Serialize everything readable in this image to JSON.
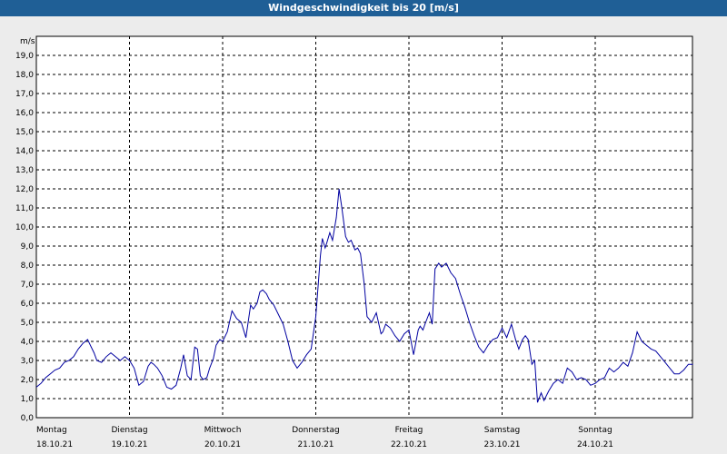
{
  "window": {
    "title": "Windgeschwindigkeit bis 20 [m/s]"
  },
  "chart_data": {
    "type": "line",
    "title": "Windgeschwindigkeit bis 20 [m/s]",
    "ylabel": "m/s",
    "ylim": [
      0,
      20
    ],
    "yticks": [
      "0,0",
      "1,0",
      "2,0",
      "3,0",
      "4,0",
      "5,0",
      "6,0",
      "7,0",
      "8,0",
      "9,0",
      "10,0",
      "11,0",
      "12,0",
      "13,0",
      "14,0",
      "15,0",
      "16,0",
      "17,0",
      "18,0",
      "19,0"
    ],
    "days": [
      {
        "name": "Montag",
        "date": "18.10.21"
      },
      {
        "name": "Dienstag",
        "date": "19.10.21"
      },
      {
        "name": "Mittwoch",
        "date": "20.10.21"
      },
      {
        "name": "Donnerstag",
        "date": "21.10.21"
      },
      {
        "name": "Freitag",
        "date": "22.10.21"
      },
      {
        "name": "Samstag",
        "date": "23.10.21"
      },
      {
        "name": "Sonntag",
        "date": "24.10.21"
      }
    ],
    "grid": true,
    "line_color": "#0000a0",
    "series": [
      {
        "x_days": [
          0.0,
          0.05,
          0.1,
          0.15,
          0.2,
          0.25,
          0.3,
          0.35,
          0.4,
          0.45,
          0.5,
          0.55,
          0.58,
          0.62,
          0.65,
          0.7,
          0.75,
          0.8,
          0.85,
          0.9,
          0.95,
          1.0,
          1.05,
          1.1,
          1.15,
          1.2,
          1.23,
          1.26,
          1.3,
          1.35,
          1.4,
          1.45,
          1.5,
          1.55,
          1.58,
          1.62,
          1.66,
          1.7,
          1.73,
          1.76,
          1.79,
          1.83,
          1.86,
          1.9,
          1.93,
          1.97,
          2.0,
          2.05,
          2.1,
          2.15,
          2.2,
          2.25,
          2.3,
          2.33,
          2.37,
          2.4,
          2.43,
          2.47,
          2.5,
          2.55,
          2.6,
          2.65,
          2.7,
          2.75,
          2.8,
          2.85,
          2.9,
          2.95,
          3.0,
          3.05,
          3.07,
          3.1,
          3.12,
          3.15,
          3.18,
          3.22,
          3.25,
          3.28,
          3.32,
          3.35,
          3.38,
          3.42,
          3.45,
          3.48,
          3.52,
          3.55,
          3.6,
          3.65,
          3.7,
          3.72,
          3.75,
          3.8,
          3.85,
          3.9,
          3.95,
          4.0,
          4.05,
          4.1,
          4.12,
          4.15,
          4.18,
          4.22,
          4.25,
          4.28,
          4.32,
          4.35,
          4.4,
          4.45,
          4.5,
          4.55,
          4.6,
          4.65,
          4.7,
          4.75,
          4.8,
          4.85,
          4.9,
          4.95,
          5.0,
          5.05,
          5.1,
          5.15,
          5.18,
          5.22,
          5.25,
          5.28,
          5.32,
          5.35,
          5.38,
          5.42,
          5.45,
          5.5,
          5.55,
          5.6,
          5.65,
          5.7,
          5.75,
          5.8,
          5.85,
          5.9,
          5.95,
          6.0,
          6.05,
          6.1,
          6.15,
          6.2,
          6.25,
          6.3,
          6.35,
          6.4,
          6.45,
          6.5,
          6.55,
          6.6,
          6.65,
          6.7,
          6.75,
          6.8,
          6.85,
          6.9,
          6.95,
          7.0,
          7.05
        ],
        "values": [
          1.6,
          1.8,
          2.1,
          2.3,
          2.5,
          2.6,
          2.9,
          3.0,
          3.2,
          3.6,
          3.9,
          4.1,
          3.8,
          3.4,
          3.0,
          2.9,
          3.2,
          3.4,
          3.2,
          3.0,
          3.2,
          3.0,
          2.6,
          1.7,
          1.9,
          2.7,
          2.9,
          2.8,
          2.6,
          2.2,
          1.6,
          1.5,
          1.7,
          2.6,
          3.3,
          2.2,
          2.0,
          3.7,
          3.6,
          2.2,
          2.0,
          2.1,
          2.6,
          3.1,
          3.8,
          4.1,
          4.0,
          4.5,
          5.6,
          5.2,
          5.0,
          4.2,
          5.9,
          5.7,
          6.0,
          6.6,
          6.7,
          6.5,
          6.2,
          5.9,
          5.4,
          4.9,
          4.0,
          3.0,
          2.6,
          2.9,
          3.3,
          3.6,
          5.3,
          8.5,
          9.4,
          8.9,
          9.2,
          9.7,
          9.3,
          10.5,
          12.0,
          11.0,
          9.5,
          9.2,
          9.3,
          8.8,
          8.9,
          8.6,
          7.0,
          5.3,
          5.0,
          5.5,
          4.4,
          4.5,
          4.9,
          4.7,
          4.3,
          4.0,
          4.4,
          4.6,
          3.3,
          4.6,
          4.8,
          4.6,
          5.0,
          5.5,
          4.9,
          7.8,
          8.1,
          7.9,
          8.1,
          7.6,
          7.3,
          6.5,
          5.8,
          5.0,
          4.3,
          3.7,
          3.4,
          3.8,
          4.1,
          4.2,
          4.7,
          4.2,
          4.9,
          4.0,
          3.6,
          4.1,
          4.3,
          4.1,
          2.8,
          3.0,
          0.8,
          1.3,
          0.9,
          1.4,
          1.8,
          2.0,
          1.8,
          2.6,
          2.4,
          2.0,
          2.1,
          2.0,
          1.7,
          1.8,
          2.0,
          2.1,
          2.6,
          2.4,
          2.6,
          2.9,
          2.7,
          3.4,
          4.5,
          4.0,
          3.8,
          3.6,
          3.5,
          3.2,
          2.9,
          2.6,
          2.3,
          2.3,
          2.5,
          2.8,
          2.8
        ]
      }
    ]
  }
}
